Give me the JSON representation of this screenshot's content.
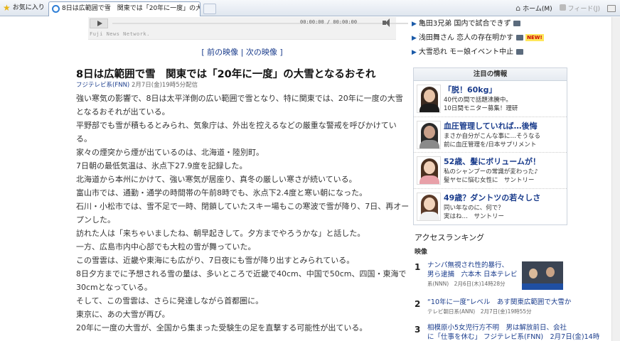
{
  "browser": {
    "favorites_label": "お気に入り",
    "tab_title": "8日は広範囲で雪　関東では「20年に一度」の大雪と...",
    "home_label": "ホーム(M)",
    "feeds_label": "フィード(J)"
  },
  "player": {
    "time": "00:00:00 / 00:00:00",
    "credit": "Fuji News Network."
  },
  "video_nav": {
    "prev": "[ 前の映像 | ",
    "next": "次の映像 ]"
  },
  "article": {
    "headline": "8日は広範囲で雪　関東では「20年に一度」の大雪となるおそれ",
    "source": "フジテレビ系(FNN)",
    "date": "2月7日(金)19時5分配信",
    "paragraphs": [
      "強い寒気の影響で、8日は太平洋側の広い範囲で雪となり、特に関東では、20年に一度の大雪",
      "となるおそれが出ている。",
      "平野部でも雪が積もるとみられ、気象庁は、外出を控えるなどの厳重な警戒を呼びかけてい",
      "る。",
      "家々の煙突から煙が出ているのは、北海道・陸別町。",
      "7日朝の最低気温は、氷点下27.9度を記録した。",
      "北海道から本州にかけて、強い寒気が居座り、真冬の厳しい寒さが続いている。",
      "富山市では、通勤・通学の時間帯の午前8時でも、氷点下2.4度と寒い朝になった。",
      "石川・小松市では、雪不足で一時、閉鎖していたスキー場もこの寒波で雪が降り、7日、再オー",
      "プンした。",
      "訪れた人は「来ちゃいましたね、朝早起きして。夕方までやろうかな」と話した。",
      "一方、広島市内中心部でも大粒の雪が舞っていた。",
      "この雪雲は、近畿や東海にも広がり、7日夜にも雪が降り出すとみられている。",
      "8日夕方までに予想される雪の量は、多いところで近畿で40cm、中国で50cm、四国・東海で",
      "30cmとなっている。",
      "そして、この雪雲は、さらに発達しながら首都圏に。",
      "東京に、あの大雪が再び。",
      "20年に一度の大雪が、全国から集まった受験生の足を直撃する可能性が出ている。"
    ]
  },
  "right_top_links": [
    {
      "text": "亀田3兄弟 国内で試合できず",
      "badge": "camera"
    },
    {
      "text": "浅田舞さん 恋人の存在明かす",
      "badge": "camera",
      "new": "NEW!"
    },
    {
      "text": "大雪恐れ モー娘イベント中止",
      "badge": "camera"
    }
  ],
  "attention": {
    "title": "注目の情報",
    "items": [
      {
        "title": "「脱！60kg」",
        "line1": "40代の間で話題沸騰中。",
        "line2": "10日間モニター募集！理研",
        "colors": {
          "hair": "#3a2a20",
          "face": "#e8c4a8",
          "cloth": "#1c1c1c"
        }
      },
      {
        "title": "血圧管理していれば…後悔",
        "line1": "まさか自分がこんな事に…そうなる",
        "line2": "前に血圧管理を/日本サプリメント",
        "colors": {
          "hair": "#2a2a2a",
          "face": "#c9a08a",
          "cloth": "#8a8a8a"
        }
      },
      {
        "title": "52歳、髪にボリュームが！",
        "line1": "私のシャンプーの常識が変わった♪",
        "line2": "髪ヤセに悩む女性に　サントリー",
        "colors": {
          "hair": "#4a3020",
          "face": "#f0d0b8",
          "cloth": "#e8a0a8"
        }
      },
      {
        "title": "49歳？ダントツの若々しさ",
        "line1": "同い年なのに、何で？",
        "line2": "実はね…　サントリー",
        "colors": {
          "hair": "#5a3a28",
          "face": "#f2d4bc",
          "cloth": "#f0f0f0"
        }
      }
    ]
  },
  "ranking": {
    "title": "アクセスランキング",
    "subtitle": "映像",
    "items": [
      {
        "num": "1",
        "lines": [
          "ナンパ無視され性的暴行、",
          "男ら逮捕　六本木 日本テレビ"
        ],
        "meta": "系(NNN)　2月6日(木)14時28分"
      },
      {
        "num": "2",
        "lines": [
          "“10年に一度”レベル　あす関東広範囲で大雪か"
        ],
        "meta": "テレビ朝日系(ANN)　2月7日(金)19時55分"
      },
      {
        "num": "3",
        "lines": [
          "相模原小5女児行方不明　男は解放前日、会社",
          "に「仕事を休む」 フジテレビ系(FNN)　2月7日(金)14時"
        ],
        "meta": ""
      }
    ]
  }
}
